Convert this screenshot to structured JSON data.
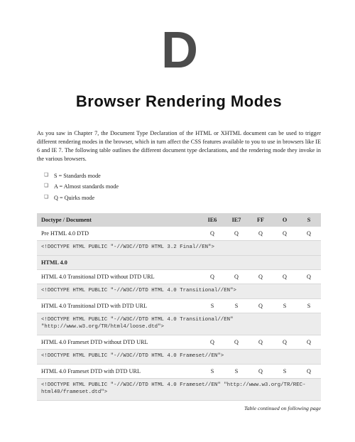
{
  "chapter_letter": "D",
  "title": "Browser Rendering Modes",
  "intro": "As you saw in Chapter 7, the Document Type Declaration of the HTML or XHTML document can be used to trigger different rendering modes in the browser, which in turn affect the CSS features available to you to use in browsers like IE 6 and IE 7. The following table outlines the different document type declarations, and the rendering mode they invoke in the various browsers.",
  "legend": [
    "S = Standards mode",
    "A = Almost standards mode",
    "Q = Quirks mode"
  ],
  "headers": {
    "doc": "Doctype / Document",
    "c1": "IE6",
    "c2": "IE7",
    "c3": "FF",
    "c4": "O",
    "c5": "S"
  },
  "rows": [
    {
      "type": "data",
      "doc": "Pre HTML 4.0 DTD",
      "v": [
        "Q",
        "Q",
        "Q",
        "Q",
        "Q"
      ]
    },
    {
      "type": "code",
      "code": "<!DOCTYPE HTML PUBLIC \"-//W3C//DTD HTML 3.2 Final//EN\">"
    },
    {
      "type": "section",
      "doc": "HTML 4.0"
    },
    {
      "type": "data",
      "doc": "HTML 4.0 Transitional DTD without DTD URL",
      "v": [
        "Q",
        "Q",
        "Q",
        "Q",
        "Q"
      ]
    },
    {
      "type": "code",
      "code": "<!DOCTYPE HTML PUBLIC \"-//W3C//DTD HTML 4.0 Transitional//EN\">"
    },
    {
      "type": "data",
      "doc": "HTML 4.0 Transitional DTD with DTD URL",
      "v": [
        "S",
        "S",
        "Q",
        "S",
        "S"
      ]
    },
    {
      "type": "code",
      "code": "<!DOCTYPE HTML PUBLIC \"-//W3C//DTD HTML 4.0 Transitional//EN\" \"http://www.w3.org/TR/html4/loose.dtd\">"
    },
    {
      "type": "data",
      "doc": "HTML 4.0 Frameset DTD without DTD URL",
      "v": [
        "Q",
        "Q",
        "Q",
        "Q",
        "Q"
      ]
    },
    {
      "type": "code",
      "code": "<!DOCTYPE HTML PUBLIC \"-//W3C//DTD HTML 4.0 Frameset//EN\">"
    },
    {
      "type": "data",
      "doc": "HTML 4.0 Frameset DTD with DTD URL",
      "v": [
        "S",
        "S",
        "Q",
        "S",
        "Q"
      ]
    },
    {
      "type": "code",
      "code": "<!DOCTYPE HTML PUBLIC \"-//W3C//DTD HTML 4.0 Frameset//EN\" \"http://www.w3.org/TR/REC-html40/frameset.dtd\">"
    }
  ],
  "footnote": "Table continued on following page"
}
